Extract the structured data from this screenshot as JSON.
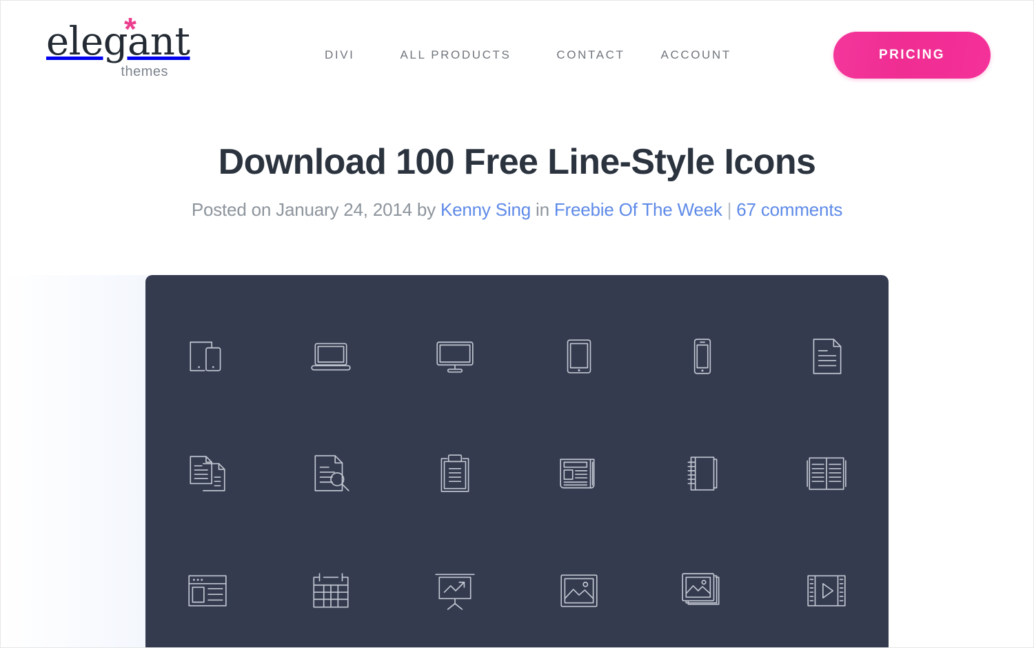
{
  "site": {
    "logo_word": "elegant",
    "logo_sub": "themes",
    "logo_asterisk": "*",
    "accent_color": "#ec3e8e",
    "link_color": "#5e8ae8",
    "panel_color": "#343b4f"
  },
  "nav": {
    "items": [
      {
        "label": "DIVI"
      },
      {
        "label": "ALL PRODUCTS"
      },
      {
        "label": "CONTACT"
      },
      {
        "label": "ACCOUNT"
      }
    ],
    "cta_label": "PRICING"
  },
  "post": {
    "title": "Download 100 Free Line-Style Icons",
    "meta": {
      "posted_prefix": "Posted on ",
      "date": "January 24, 2014",
      "by_text": " by ",
      "author": "Kenny Sing",
      "in_text": " in ",
      "category": "Freebie Of The Week",
      "separator": " | ",
      "comments": "67 comments"
    }
  },
  "feature": {
    "icons": [
      {
        "name": "devices-tablet-phone-icon"
      },
      {
        "name": "laptop-icon"
      },
      {
        "name": "desktop-monitor-icon"
      },
      {
        "name": "tablet-icon"
      },
      {
        "name": "smartphone-icon"
      },
      {
        "name": "document-icon"
      },
      {
        "name": "copy-documents-icon"
      },
      {
        "name": "document-search-icon"
      },
      {
        "name": "clipboard-icon"
      },
      {
        "name": "newspaper-icon"
      },
      {
        "name": "spiral-notebook-icon"
      },
      {
        "name": "open-book-icon"
      },
      {
        "name": "browser-window-icon"
      },
      {
        "name": "calendar-icon"
      },
      {
        "name": "presentation-chart-icon"
      },
      {
        "name": "image-icon"
      },
      {
        "name": "image-gallery-icon"
      },
      {
        "name": "film-video-icon"
      }
    ]
  }
}
